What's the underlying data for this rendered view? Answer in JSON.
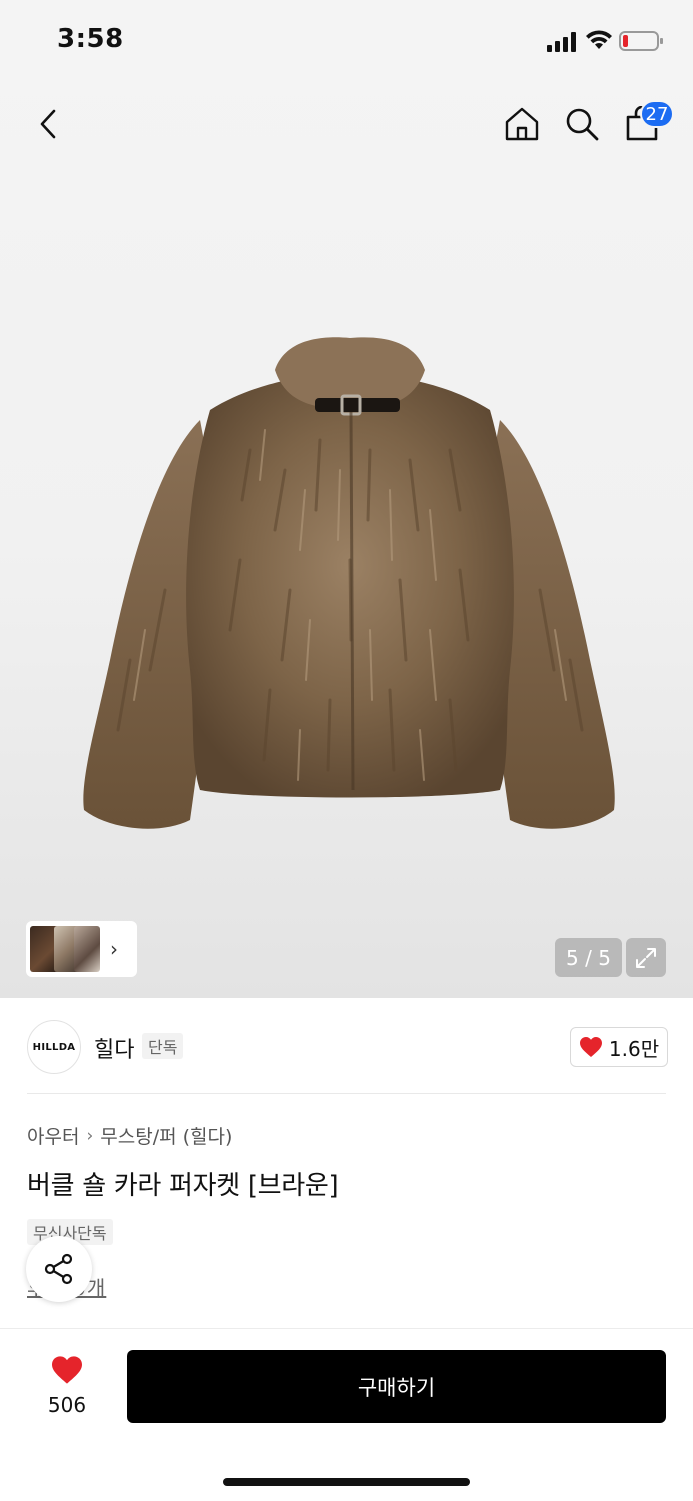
{
  "status_bar": {
    "time": "3:58"
  },
  "nav": {
    "cart_count": "27"
  },
  "gallery": {
    "page_indicator": "5 / 5"
  },
  "brand": {
    "logo_text": "HILLDA",
    "name": "힐다",
    "tag": "단독",
    "likes": "1.6만"
  },
  "product": {
    "breadcrumb": [
      "아우터",
      "무스탕/퍼 (힐다)"
    ],
    "title": "버클 숄 카라 퍼자켓 [브라운]",
    "badge": "무신사단독",
    "review_link": "후기 0개"
  },
  "bottom_bar": {
    "wish_count": "506",
    "buy_label": "구매하기"
  },
  "colors": {
    "accent": "#1c6cf2",
    "heart": "#e5242b",
    "buy_button": "#000000"
  }
}
